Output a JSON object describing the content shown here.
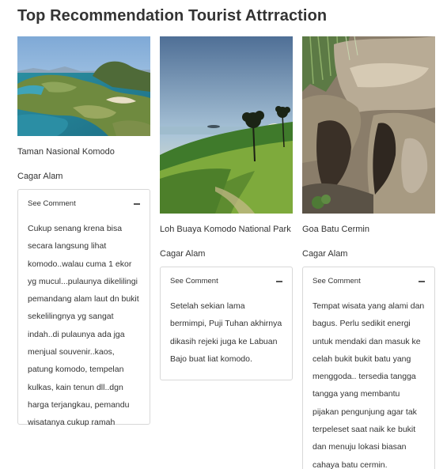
{
  "page": {
    "title": "Top Recommendation Tourist Attrraction"
  },
  "cards": [
    {
      "image_icon": "island-landscape-photo",
      "name": "Taman Nasional Komodo",
      "category": "Cagar Alam",
      "comment_label": "See Comment",
      "comment": "Cukup senang krena bisa secara langsung lihat komodo..walau cuma 1 ekor yg mucul...pulaunya dikelilingi pemandang alam laut dn bukit sekelilingnya yg sangat indah..di pulaunya ada jga menjual souvenir..kaos, patung komodo, tempelan kulkas, kain tenun dll..dgn harga terjangkau, pemandu wisatanya cukup ramah"
    },
    {
      "image_icon": "hillside-palm-sunset-photo",
      "name": "Loh Buaya Komodo National Park",
      "category": "Cagar Alam",
      "comment_label": "See Comment",
      "comment": "Setelah sekian lama bermimpi, Puji Tuhan akhirnya dikasih rejeki juga ke Labuan Bajo buat liat komodo."
    },
    {
      "image_icon": "limestone-cave-photo",
      "name": "Goa Batu Cermin",
      "category": "Cagar Alam",
      "comment_label": "See Comment",
      "comment": "Tempat wisata yang alami dan bagus. Perlu sedikit energi untuk mendaki dan masuk ke celah bukit bukit batu yang menggoda.. tersedia tangga tangga yang membantu pijakan pengunjung agar tak terpeleset saat naik ke bukit dan menuju lokasi biasan cahaya batu cermin."
    }
  ],
  "colors": {
    "text": "#333333",
    "border": "#d8d8d8"
  }
}
